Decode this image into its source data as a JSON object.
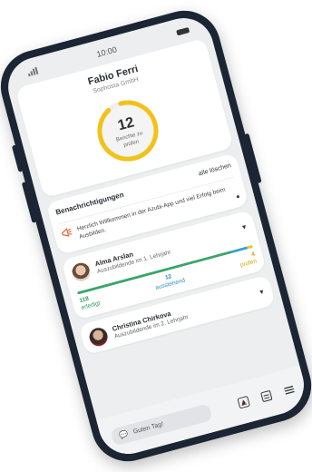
{
  "status_bar": {
    "time": "10:00"
  },
  "profile": {
    "name": "Fabio Ferri",
    "company": "Sophosta GmbH"
  },
  "reports_ring": {
    "count": "12",
    "label": "Berichte zu prüfen",
    "progress_fraction": 0.92
  },
  "notifications": {
    "title": "Benachrichtigungen",
    "clear_all": "alle löschen",
    "items": [
      {
        "text": "Herzlich Willkommen in der Azubi-App und viel Erfolg beim Ausbilden."
      }
    ]
  },
  "trainees": [
    {
      "name": "Alma Arslan",
      "role": "Auszubildende im 1. Lehrjahr",
      "stats": [
        {
          "value": "118",
          "label": "erledigt"
        },
        {
          "value": "12",
          "label": "ausstehend"
        },
        {
          "value": "4",
          "label": "prüfen"
        }
      ]
    },
    {
      "name": "Christina Chirkova",
      "role": "Auszubildende im 2. Lehrjahr"
    }
  ],
  "bottom_bar": {
    "greeting": "Guten Tag!"
  },
  "colors": {
    "ring": "#f2c21a",
    "accent_green": "#3aa56a",
    "accent_blue": "#3aa0d8",
    "frame": "#1b2534"
  }
}
